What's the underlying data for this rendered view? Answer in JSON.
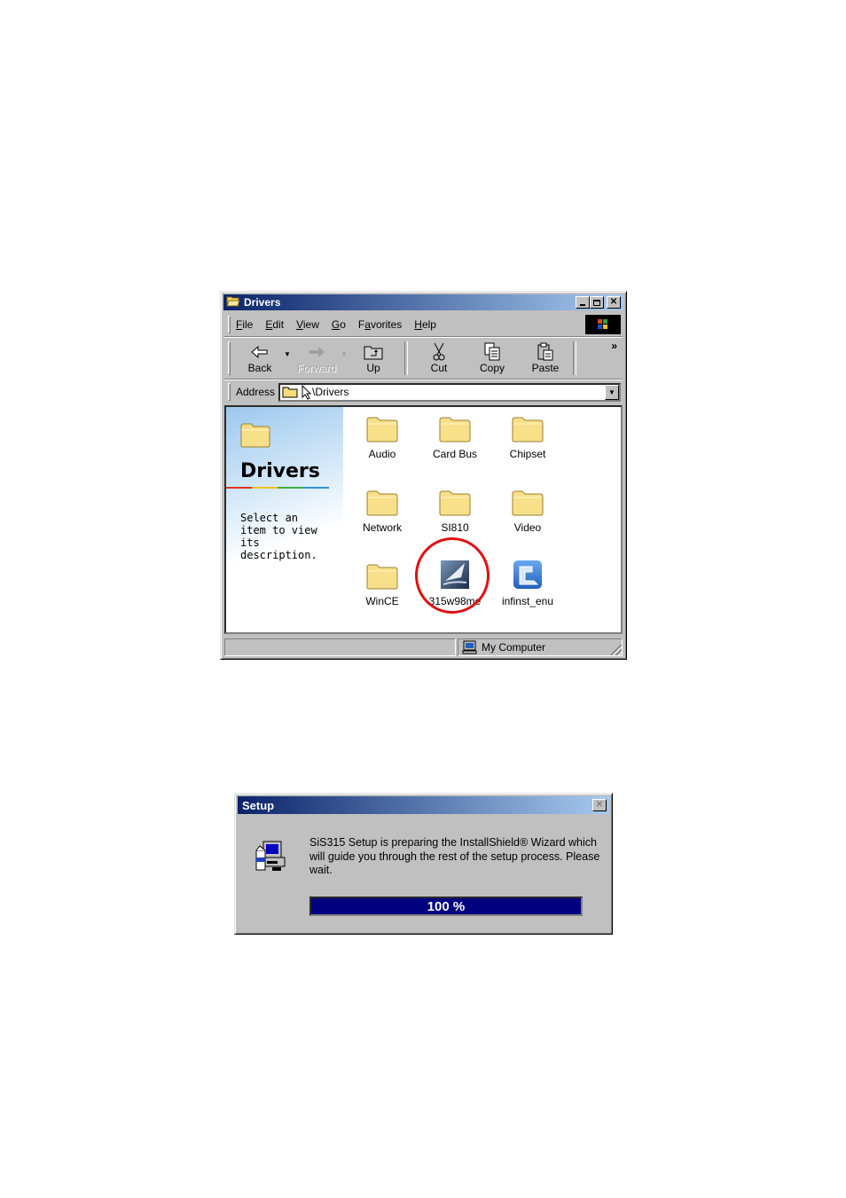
{
  "explorer": {
    "title": "Drivers",
    "menu": [
      {
        "label": "File",
        "accel": "F"
      },
      {
        "label": "Edit",
        "accel": "E"
      },
      {
        "label": "View",
        "accel": "V"
      },
      {
        "label": "Go",
        "accel": "G"
      },
      {
        "label": "Favorites",
        "accel": "a"
      },
      {
        "label": "Help",
        "accel": "H"
      }
    ],
    "toolbar": {
      "back": "Back",
      "forward": "Forward",
      "up": "Up",
      "cut": "Cut",
      "copy": "Copy",
      "paste": "Paste",
      "more": "»"
    },
    "address": {
      "label": "Address",
      "value": "\\Drivers"
    },
    "left_pane": {
      "title": "Drivers",
      "description": "Select an item to view its description."
    },
    "items": [
      {
        "label": "Audio",
        "type": "folder"
      },
      {
        "label": "Card Bus",
        "type": "folder"
      },
      {
        "label": "Chipset",
        "type": "folder"
      },
      {
        "label": "Network",
        "type": "folder"
      },
      {
        "label": "SI810",
        "type": "folder"
      },
      {
        "label": "Video",
        "type": "folder"
      },
      {
        "label": "WinCE",
        "type": "folder"
      },
      {
        "label": "315w98me",
        "type": "setup-app",
        "highlighted": true
      },
      {
        "label": "infinst_enu",
        "type": "installer-app"
      }
    ],
    "status": {
      "zone": "My Computer"
    }
  },
  "setup_dialog": {
    "title": "Setup",
    "message": "SiS315 Setup is preparing the InstallShield® Wizard which will guide you through the rest of the setup process. Please wait.",
    "progress_percent": 100,
    "progress_label": "100 %"
  },
  "colors": {
    "title_start": "#0a246a",
    "title_end": "#a6caf0",
    "progress_fill": "#000080",
    "highlight_circle": "#e01010",
    "window_face": "#c0c0c0"
  }
}
